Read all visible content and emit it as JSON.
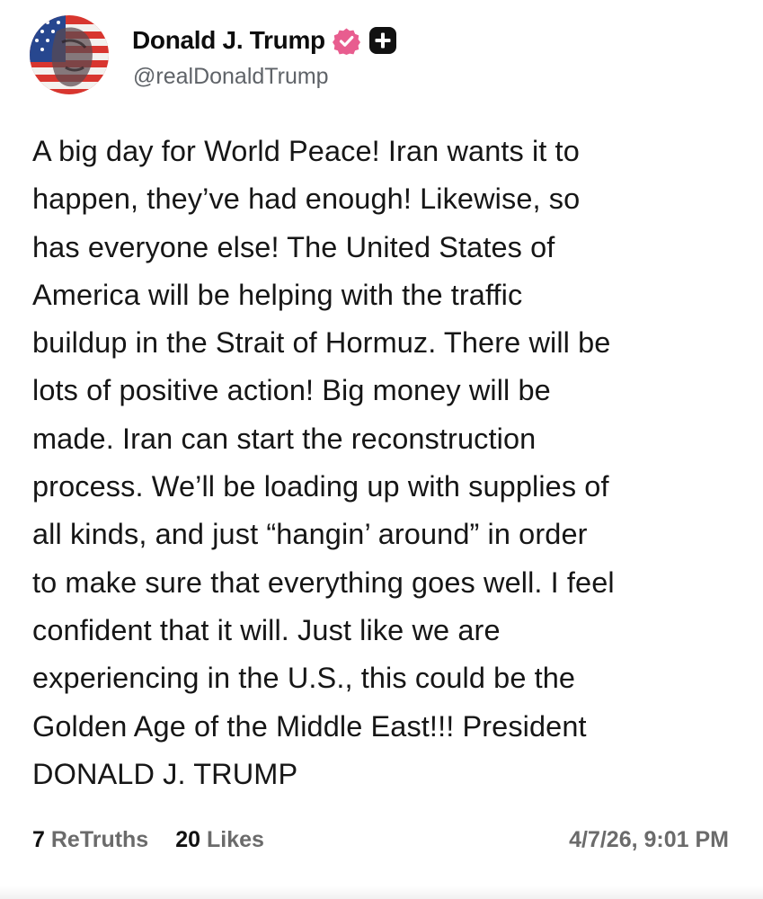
{
  "author": {
    "display_name": "Donald J. Trump",
    "handle": "@realDonaldTrump",
    "verified_color": "#e85d8f",
    "avatar_icon": "flag-portrait-avatar",
    "follow_icon": "plus-icon"
  },
  "post": {
    "lines": [
      "A big day for World Peace! Iran wants it to",
      "happen, they’ve had enough! Likewise, so",
      "has everyone else! The United States of",
      "America will be helping with the traffic",
      "buildup in the Strait of Hormuz. There will be",
      "lots of positive action! Big money will be",
      "made. Iran can start the reconstruction",
      "process. We’ll be loading up with supplies of",
      "all kinds, and just “hangin’ around” in order",
      "to make sure that everything goes well. I feel",
      "confident that it will. Just like we are",
      "experiencing in the U.S., this could be the",
      "Golden Age of the Middle East!!! President",
      "DONALD J. TRUMP"
    ]
  },
  "stats": {
    "retruths_count": "7",
    "retruths_label": "ReTruths",
    "likes_count": "20",
    "likes_label": "Likes",
    "timestamp": "4/7/26, 9:01 PM"
  }
}
